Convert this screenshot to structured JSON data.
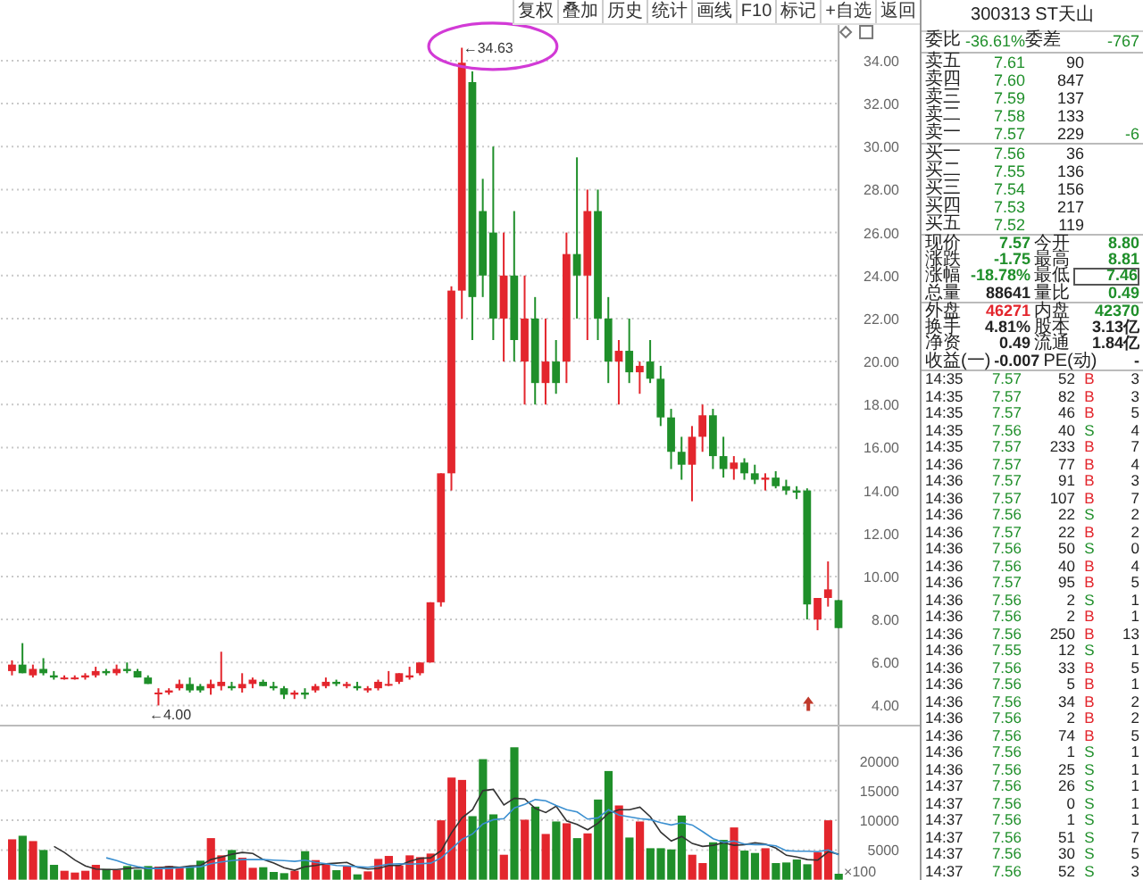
{
  "toolbar": [
    "复权",
    "叠加",
    "历史",
    "统计",
    "画线",
    "F10",
    "标记",
    "+自选",
    "返回"
  ],
  "price_chart": {
    "chart_data": {
      "type": "candlestick",
      "grid": true,
      "ylim": [
        3.09,
        36.82
      ],
      "yticks": [
        {
          "value": 4,
          "label": "4.00"
        },
        {
          "value": 6,
          "label": "6.00"
        },
        {
          "value": 8,
          "label": "8.00"
        },
        {
          "value": 10,
          "label": "10.00"
        },
        {
          "value": 12,
          "label": "12.00"
        },
        {
          "value": 14,
          "label": "14.00"
        },
        {
          "value": 16,
          "label": "16.00"
        },
        {
          "value": 18,
          "label": "18.00"
        },
        {
          "value": 20,
          "label": "20.00"
        },
        {
          "value": 22,
          "label": "22.00"
        },
        {
          "value": 24,
          "label": "24.00"
        },
        {
          "value": 26,
          "label": "26.00"
        },
        {
          "value": 28,
          "label": "28.00"
        },
        {
          "value": 30,
          "label": "30.00"
        },
        {
          "value": 32,
          "label": "32.00"
        },
        {
          "value": 34,
          "label": "34.00"
        }
      ],
      "ohlc": [
        [
          5.6,
          6.1,
          5.4,
          5.9
        ],
        [
          5.9,
          6.9,
          5.5,
          5.5
        ],
        [
          5.4,
          5.9,
          5.3,
          5.7
        ],
        [
          5.7,
          6.2,
          5.4,
          5.5
        ],
        [
          5.4,
          5.6,
          5.2,
          5.3
        ],
        [
          5.3,
          5.4,
          5.2,
          5.3
        ],
        [
          5.3,
          5.4,
          5.2,
          5.3
        ],
        [
          5.3,
          5.5,
          5.2,
          5.4
        ],
        [
          5.4,
          5.8,
          5.3,
          5.6
        ],
        [
          5.6,
          5.7,
          5.4,
          5.5
        ],
        [
          5.5,
          5.9,
          5.4,
          5.7
        ],
        [
          5.7,
          6.0,
          5.5,
          5.6
        ],
        [
          5.6,
          5.7,
          5.3,
          5.3
        ],
        [
          5.3,
          5.4,
          5.0,
          5.0
        ],
        [
          4.6,
          4.8,
          4.0,
          4.6
        ],
        [
          4.6,
          4.8,
          4.5,
          4.7
        ],
        [
          4.8,
          5.2,
          4.7,
          5.0
        ],
        [
          5.0,
          5.3,
          4.6,
          4.7
        ],
        [
          4.9,
          5.0,
          4.6,
          4.7
        ],
        [
          4.8,
          5.2,
          4.5,
          5.0
        ],
        [
          4.9,
          6.5,
          4.7,
          5.1
        ],
        [
          4.9,
          5.1,
          4.7,
          4.8
        ],
        [
          4.8,
          5.5,
          4.6,
          5.0
        ],
        [
          5.0,
          5.3,
          4.8,
          5.2
        ],
        [
          5.1,
          5.2,
          4.9,
          4.9
        ],
        [
          4.9,
          5.1,
          4.7,
          4.8
        ],
        [
          4.8,
          4.9,
          4.3,
          4.5
        ],
        [
          4.5,
          4.7,
          4.3,
          4.6
        ],
        [
          4.6,
          4.8,
          4.3,
          4.5
        ],
        [
          4.7,
          5.0,
          4.6,
          4.9
        ],
        [
          4.9,
          5.3,
          4.8,
          5.1
        ],
        [
          5.1,
          5.2,
          4.9,
          5.0
        ],
        [
          4.9,
          5.1,
          4.8,
          5.0
        ],
        [
          4.9,
          5.1,
          4.7,
          4.8
        ],
        [
          4.7,
          4.9,
          4.6,
          4.8
        ],
        [
          4.8,
          5.2,
          4.7,
          5.1
        ],
        [
          5.0,
          5.6,
          4.9,
          5.0
        ],
        [
          5.1,
          5.5,
          5.0,
          5.5
        ],
        [
          5.3,
          5.8,
          5.2,
          5.4
        ],
        [
          5.5,
          6.0,
          5.4,
          6.0
        ],
        [
          6.0,
          8.8,
          6.0,
          8.8
        ],
        [
          8.8,
          14.8,
          8.6,
          14.8
        ],
        [
          14.8,
          23.5,
          14,
          23.3
        ],
        [
          23.3,
          34.6,
          22,
          33.9
        ],
        [
          33,
          33.5,
          21,
          23
        ],
        [
          27,
          28.5,
          23,
          24
        ],
        [
          26,
          30,
          21,
          22
        ],
        [
          22,
          26,
          20,
          24
        ],
        [
          24,
          27,
          20,
          21
        ],
        [
          20,
          24,
          18,
          22
        ],
        [
          22,
          23,
          18,
          19
        ],
        [
          19,
          22,
          18,
          20
        ],
        [
          20,
          21,
          18.5,
          19
        ],
        [
          20,
          26,
          19,
          25
        ],
        [
          25,
          29.5,
          22,
          24
        ],
        [
          24,
          28,
          21,
          27
        ],
        [
          27,
          28,
          21,
          22
        ],
        [
          22,
          23,
          19,
          20
        ],
        [
          20,
          21,
          18,
          20.5
        ],
        [
          20.5,
          22,
          19,
          19.5
        ],
        [
          19.5,
          20,
          18.5,
          19.8
        ],
        [
          20,
          21,
          19,
          19.2
        ],
        [
          19.2,
          19.8,
          17,
          17.4
        ],
        [
          17.4,
          17.8,
          15,
          15.8
        ],
        [
          15.8,
          16.5,
          14.5,
          15.2
        ],
        [
          15.2,
          17,
          13.5,
          16.5
        ],
        [
          16.5,
          18,
          15.8,
          17.5
        ],
        [
          17.5,
          17.8,
          15,
          15.6
        ],
        [
          15.6,
          16.5,
          14.6,
          15
        ],
        [
          15,
          15.6,
          14.5,
          15.3
        ],
        [
          15.3,
          15.5,
          14.5,
          14.8
        ],
        [
          14.8,
          15.2,
          14.3,
          14.5
        ],
        [
          14.5,
          14.8,
          14,
          14.6
        ],
        [
          14.6,
          14.9,
          14.1,
          14.2
        ],
        [
          14.2,
          14.5,
          13.8,
          14
        ],
        [
          14,
          14.2,
          13.6,
          13.9
        ],
        [
          14,
          14.1,
          8,
          8.7
        ],
        [
          8,
          9,
          7.5,
          9
        ],
        [
          9,
          10.7,
          8.6,
          9.4
        ],
        [
          8.9,
          8.9,
          7.6,
          7.6
        ]
      ],
      "annotations": [
        "←34.63",
        "←4.00"
      ]
    }
  },
  "volume_chart": {
    "chart_data": {
      "type": "bar",
      "stacked": false,
      "grid": true,
      "ylabel": "×100",
      "ylim": [
        0,
        25800
      ],
      "yticks": [
        {
          "value": 5000,
          "label": "5000"
        },
        {
          "value": 10000,
          "label": "10000"
        },
        {
          "value": 15000,
          "label": "15000"
        },
        {
          "value": 20000,
          "label": "20000"
        }
      ],
      "series": [
        {
          "colors": [
            "#e3262d",
            "#1f8f2a",
            "#e3262d",
            "#1f8f2a",
            "#1f8f2a",
            "#e3262d",
            "#e3262d",
            "#e3262d",
            "#e3262d",
            "#1f8f2a",
            "#e3262d",
            "#1f8f2a",
            "#1f8f2a",
            "#1f8f2a",
            "#e3262d",
            "#e3262d",
            "#e3262d",
            "#1f8f2a",
            "#1f8f2a",
            "#e3262d",
            "#e3262d",
            "#1f8f2a",
            "#e3262d",
            "#e3262d",
            "#1f8f2a",
            "#1f8f2a",
            "#1f8f2a",
            "#e3262d",
            "#1f8f2a",
            "#e3262d",
            "#e3262d",
            "#1f8f2a",
            "#e3262d",
            "#1f8f2a",
            "#e3262d",
            "#e3262d",
            "#e3262d",
            "#e3262d",
            "#e3262d",
            "#e3262d",
            "#e3262d",
            "#e3262d",
            "#e3262d",
            "#e3262d",
            "#1f8f2a",
            "#1f8f2a",
            "#1f8f2a",
            "#e3262d",
            "#1f8f2a",
            "#e3262d",
            "#1f8f2a",
            "#e3262d",
            "#1f8f2a",
            "#e3262d",
            "#1f8f2a",
            "#e3262d",
            "#1f8f2a",
            "#1f8f2a",
            "#e3262d",
            "#1f8f2a",
            "#e3262d",
            "#1f8f2a",
            "#1f8f2a",
            "#1f8f2a",
            "#1f8f2a",
            "#e3262d",
            "#e3262d",
            "#1f8f2a",
            "#1f8f2a",
            "#e3262d",
            "#1f8f2a",
            "#1f8f2a",
            "#e3262d",
            "#1f8f2a",
            "#1f8f2a",
            "#1f8f2a",
            "#1f8f2a",
            "#e3262d",
            "#e3262d",
            "#1f8f2a"
          ],
          "values": [
            6800,
            7400,
            6500,
            5000,
            2500,
            1500,
            1200,
            1500,
            2500,
            1800,
            1600,
            2300,
            1700,
            2300,
            2200,
            2300,
            2200,
            2300,
            3200,
            7000,
            4100,
            5000,
            3700,
            2000,
            2100,
            1300,
            1100,
            1500,
            4800,
            3300,
            2600,
            1600,
            2300,
            900,
            1400,
            3500,
            4000,
            2400,
            4100,
            3800,
            4400,
            10000,
            17200,
            16800,
            10700,
            20300,
            11000,
            4200,
            22300,
            10100,
            12300,
            7700,
            9800,
            9500,
            7000,
            7800,
            13500,
            18300,
            12500,
            7100,
            9800,
            5300,
            5300,
            5100,
            10800,
            4200,
            2800,
            6300,
            6700,
            8800,
            4900,
            4500,
            5300,
            2800,
            2900,
            3400,
            2600,
            4600,
            10000,
            1000
          ]
        },
        {
          "type": "line",
          "color": "#333333",
          "values": [
            null,
            null,
            null,
            null,
            5600,
            4600,
            3300,
            2300,
            1800,
            1700,
            1700,
            1900,
            2000,
            1900,
            2000,
            2200,
            2100,
            2300,
            2400,
            3400,
            3800,
            4300,
            4600,
            4400,
            3400,
            2800,
            2000,
            1600,
            2200,
            2400,
            2700,
            2800,
            2900,
            2100,
            1800,
            1900,
            2400,
            2400,
            3100,
            3600,
            3700,
            4900,
            7900,
            10400,
            11800,
            15000,
            15200,
            12600,
            13700,
            13600,
            12000,
            11300,
            12400,
            9900,
            9300,
            8400,
            9500,
            11200,
            11800,
            11800,
            12200,
            10600,
            8000,
            6500,
            7300,
            6100,
            5600,
            5800,
            6200,
            5800,
            5900,
            6200,
            6000,
            5300,
            4100,
            3800,
            3400,
            3300,
            4700,
            4300
          ]
        },
        {
          "type": "line",
          "color": "#3a8fd0",
          "values": [
            null,
            null,
            null,
            null,
            null,
            null,
            null,
            null,
            null,
            3700,
            3200,
            2600,
            2200,
            1900,
            1900,
            1900,
            2000,
            2100,
            2200,
            2700,
            3000,
            3200,
            3400,
            3400,
            3400,
            3300,
            3200,
            3100,
            3300,
            2900,
            2700,
            2400,
            2300,
            2200,
            2100,
            2300,
            2600,
            2700,
            2600,
            2700,
            2800,
            3700,
            5200,
            6800,
            7700,
            9400,
            10100,
            10300,
            12100,
            12700,
            13500,
            13300,
            12500,
            11800,
            11400,
            10200,
            10400,
            11800,
            10900,
            10600,
            10300,
            10100,
            9600,
            9200,
            9600,
            9200,
            8100,
            6900,
            6300,
            6500,
            6000,
            5900,
            5900,
            5700,
            4900,
            4800,
            4800,
            4700,
            5000,
            4200
          ]
        }
      ]
    }
  },
  "quote": {
    "title": "300313 ST天山",
    "ratio": {
      "label": "委比",
      "value": "-36.61%",
      "label2": "委差",
      "value2": "-767"
    },
    "asks": [
      {
        "label": "卖五",
        "price": "7.61",
        "volume": "90"
      },
      {
        "label": "卖四",
        "price": "7.60",
        "volume": "847"
      },
      {
        "label": "卖三",
        "price": "7.59",
        "volume": "137"
      },
      {
        "label": "卖二",
        "price": "7.58",
        "volume": "133"
      },
      {
        "label": "卖一",
        "price": "7.57",
        "volume": "229",
        "change": "-6"
      }
    ],
    "bids": [
      {
        "label": "买一",
        "price": "7.56",
        "volume": "36"
      },
      {
        "label": "买二",
        "price": "7.55",
        "volume": "136"
      },
      {
        "label": "买三",
        "price": "7.54",
        "volume": "156"
      },
      {
        "label": "买四",
        "price": "7.53",
        "volume": "217"
      },
      {
        "label": "买五",
        "price": "7.52",
        "volume": "119"
      }
    ],
    "stats": [
      {
        "label": "现价",
        "value": "7.57",
        "color": "#1f8f2a",
        "boxed": false
      },
      {
        "label": "今开",
        "value": "8.80",
        "color": "#1f8f2a",
        "boxed": false
      },
      {
        "label": "涨跌",
        "value": "-1.75",
        "color": "#1f8f2a",
        "boxed": false
      },
      {
        "label": "最高",
        "value": "8.81",
        "color": "#1f8f2a",
        "boxed": false
      },
      {
        "label": "涨幅",
        "value": "-18.78%",
        "color": "#1f8f2a",
        "boxed": false
      },
      {
        "label": "最低",
        "value": "7.46",
        "color": "#1f8f2a",
        "boxed": true
      },
      {
        "label": "总量",
        "value": "88641",
        "color": "#222222",
        "boxed": false
      },
      {
        "label": "量比",
        "value": "0.49",
        "color": "#1f8f2a",
        "boxed": false
      },
      {
        "label": "外盘",
        "value": "46271",
        "color": "#e3262d",
        "boxed": false
      },
      {
        "label": "内盘",
        "value": "42370",
        "color": "#1f8f2a",
        "boxed": false
      },
      {
        "label": "换手",
        "value": "4.81%",
        "color": "#222222",
        "boxed": false
      },
      {
        "label": "股本",
        "value": "3.13亿",
        "color": "#222222",
        "boxed": false
      },
      {
        "label": "净资",
        "value": "0.49",
        "color": "#222222",
        "boxed": false
      },
      {
        "label": "流通",
        "value": "1.84亿",
        "color": "#222222",
        "boxed": false
      },
      {
        "label": "收益(一)",
        "value": "-0.007",
        "color": "#222222",
        "boxed": false
      },
      {
        "label": "PE(动)",
        "value": "-",
        "color": "#222222",
        "boxed": false
      }
    ],
    "trades": [
      {
        "time": "14:35",
        "price": "7.57",
        "volume": "52",
        "side": "B",
        "color": "#e3262d",
        "count": "3"
      },
      {
        "time": "14:35",
        "price": "7.57",
        "volume": "82",
        "side": "B",
        "color": "#e3262d",
        "count": "3"
      },
      {
        "time": "14:35",
        "price": "7.57",
        "volume": "46",
        "side": "B",
        "color": "#e3262d",
        "count": "5"
      },
      {
        "time": "14:35",
        "price": "7.56",
        "volume": "40",
        "side": "S",
        "color": "#1f8f2a",
        "count": "4"
      },
      {
        "time": "14:35",
        "price": "7.57",
        "volume": "233",
        "side": "B",
        "color": "#e3262d",
        "count": "7"
      },
      {
        "time": "14:36",
        "price": "7.57",
        "volume": "77",
        "side": "B",
        "color": "#e3262d",
        "count": "4"
      },
      {
        "time": "14:36",
        "price": "7.57",
        "volume": "91",
        "side": "B",
        "color": "#e3262d",
        "count": "3"
      },
      {
        "time": "14:36",
        "price": "7.57",
        "volume": "107",
        "side": "B",
        "color": "#e3262d",
        "count": "7"
      },
      {
        "time": "14:36",
        "price": "7.56",
        "volume": "22",
        "side": "S",
        "color": "#1f8f2a",
        "count": "2"
      },
      {
        "time": "14:36",
        "price": "7.57",
        "volume": "22",
        "side": "B",
        "color": "#e3262d",
        "count": "2"
      },
      {
        "time": "14:36",
        "price": "7.56",
        "volume": "50",
        "side": "S",
        "color": "#1f8f2a",
        "count": "0"
      },
      {
        "time": "14:36",
        "price": "7.56",
        "volume": "40",
        "side": "B",
        "color": "#e3262d",
        "count": "4"
      },
      {
        "time": "14:36",
        "price": "7.57",
        "volume": "95",
        "side": "B",
        "color": "#e3262d",
        "count": "5"
      },
      {
        "time": "14:36",
        "price": "7.56",
        "volume": "2",
        "side": "S",
        "color": "#1f8f2a",
        "count": "1"
      },
      {
        "time": "14:36",
        "price": "7.56",
        "volume": "2",
        "side": "B",
        "color": "#e3262d",
        "count": "1"
      },
      {
        "time": "14:36",
        "price": "7.56",
        "volume": "250",
        "side": "B",
        "color": "#e3262d",
        "count": "13"
      },
      {
        "time": "14:36",
        "price": "7.55",
        "volume": "12",
        "side": "S",
        "color": "#1f8f2a",
        "count": "1"
      },
      {
        "time": "14:36",
        "price": "7.56",
        "volume": "33",
        "side": "B",
        "color": "#e3262d",
        "count": "5"
      },
      {
        "time": "14:36",
        "price": "7.56",
        "volume": "5",
        "side": "B",
        "color": "#e3262d",
        "count": "1"
      },
      {
        "time": "14:36",
        "price": "7.56",
        "volume": "34",
        "side": "B",
        "color": "#e3262d",
        "count": "2"
      },
      {
        "time": "14:36",
        "price": "7.56",
        "volume": "2",
        "side": "B",
        "color": "#e3262d",
        "count": "2"
      },
      {
        "time": "14:36",
        "price": "7.56",
        "volume": "74",
        "side": "B",
        "color": "#e3262d",
        "count": "5"
      },
      {
        "time": "14:36",
        "price": "7.56",
        "volume": "1",
        "side": "S",
        "color": "#1f8f2a",
        "count": "1"
      },
      {
        "time": "14:36",
        "price": "7.56",
        "volume": "25",
        "side": "S",
        "color": "#1f8f2a",
        "count": "1"
      },
      {
        "time": "14:37",
        "price": "7.56",
        "volume": "26",
        "side": "S",
        "color": "#1f8f2a",
        "count": "1"
      },
      {
        "time": "14:37",
        "price": "7.56",
        "volume": "0",
        "side": "S",
        "color": "#1f8f2a",
        "count": "1"
      },
      {
        "time": "14:37",
        "price": "7.56",
        "volume": "1",
        "side": "S",
        "color": "#1f8f2a",
        "count": "1"
      },
      {
        "time": "14:37",
        "price": "7.56",
        "volume": "51",
        "side": "S",
        "color": "#1f8f2a",
        "count": "7"
      },
      {
        "time": "14:37",
        "price": "7.56",
        "volume": "30",
        "side": "S",
        "color": "#1f8f2a",
        "count": "5"
      },
      {
        "time": "14:37",
        "price": "7.56",
        "volume": "52",
        "side": "S",
        "color": "#1f8f2a",
        "count": "3"
      }
    ]
  }
}
